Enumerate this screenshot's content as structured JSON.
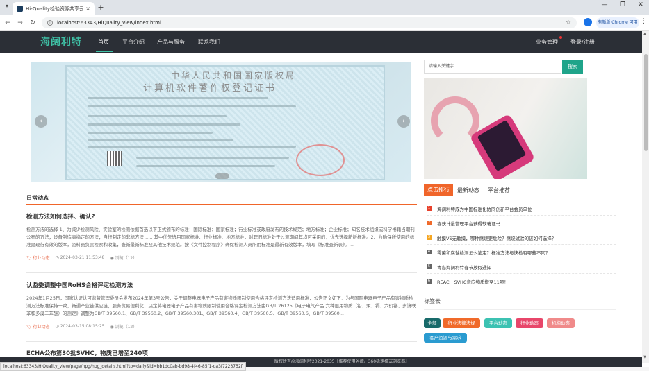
{
  "browser": {
    "tab_title": "Hi-Quality检验资源共享云平台",
    "tab_close": "×",
    "new_tab": "+",
    "url": "localhost:63343/HiQuality_view/index.html",
    "update_button": "有新版 Chrome 可用",
    "status_url": "localhost:63343/HiQuality_view/page/hpg/hpg_details.html?to=daily&id=bb1dc0ab-bd98-4f46-85f1-da3f7223752f"
  },
  "site": {
    "logo": "海阔利特",
    "nav": [
      "首页",
      "平台介绍",
      "产品与服务",
      "联系我们"
    ],
    "nav_right": [
      "业务管理",
      "登录/注册"
    ]
  },
  "main": {
    "section_title": "日常动态",
    "articles": [
      {
        "title": "检测方法如何选择、确认?",
        "body": "检测方法的选择 1、为减少检测风险、实验室的检测依据首选以下正式颁布的标准：国际标准；国家标准；行业标准或政府发布的技术规范；地方标准；企业标准；知名技术组织或科学书籍当期刊公布的方法；设备制造商指定的方法；自行制定的非标方法 ..... 其中优先选用国家标准、行业标准、地方标准，对职旧标准处于过渡期间其均可采用的，优先选择新版标准。2、为确保所使用的标准是现行有效的版本，资料员负责检索和收集，查新最新标准及其他技术规范。按《文件控制程序》确保检测人员所用标准是最新有效版本，填写《标准查新表》。...",
        "tag": "行业动态",
        "date": "2024-03-21 11:53:48",
        "views": "浏览（12）"
      },
      {
        "title": "认监委调整中国RoHS合格评定检测方法",
        "body": "2024年1月25日，国家认证认可监督管理委员会发布2024年第3号公告，关于调整电器电子产品有害物质限制使用合格评定检测方法适用标准，公告正文如下：为与国际电器电子产品有害物质检测方法标准保持一致，畅通产业链供应链，服务贸易便利化，决定将电器电子产品有害物质限制使用合格评定检测方法由GB/T 26125《电子电气产品 六种限用物质（铅、汞、镉、六价铬、多溴联苯和多溴二苯醚）的测定》调整为GB/T 39560.1、GB/T 39560.2、GB/T 39560.301、GB/T 39560.4、GB/T 39560.5、GB/T 39560.6、GB/T 39560...",
        "tag": "行业动态",
        "date": "2024-03-15 08:15:25",
        "views": "浏览（12）"
      },
      {
        "title": "ECHA公布第30批SVHC，物质已增至240项"
      }
    ]
  },
  "sidebar": {
    "search_placeholder": "请输入关键字",
    "search_button": "搜索",
    "rank_tabs": [
      "点击排行",
      "最新动态",
      "平台推荐"
    ],
    "rank_items": [
      {
        "num": "1",
        "text": "海阔利特成为中国标准化协同创新平台会员单位",
        "color": "#e8412c"
      },
      {
        "num": "2",
        "text": "喜获计量管理平台获得软著证书",
        "color": "#f06a2a"
      },
      {
        "num": "3",
        "text": "触摸VS无触摸，哪种燃烧更危险？燃烧试验的该如何选择？",
        "color": "#f5a623"
      },
      {
        "num": "4",
        "text": "霉菌和腐蚀检测怎么鉴定？标准方法与快检有哪些不同？",
        "color": "#666666"
      },
      {
        "num": "5",
        "text": "青岛海阔利特春节放假通知",
        "color": "#666666"
      },
      {
        "num": "6",
        "text": "REACH SVHC意向物质增至11项！",
        "color": "#666666"
      }
    ],
    "tagcloud_title": "标签云",
    "tags": [
      {
        "label": "全部",
        "color": "#186a6a"
      },
      {
        "label": "行业法律法规",
        "color": "#f06a2a"
      },
      {
        "label": "平台动态",
        "color": "#3cc2b2"
      },
      {
        "label": "行业动态",
        "color": "#e8466a"
      },
      {
        "label": "机构动态",
        "color": "#f08a8a"
      },
      {
        "label": "客户资源与需求",
        "color": "#2a9bd0"
      }
    ]
  },
  "footer": {
    "copyright": "版权所有@海阔利特2021-2035【推荐使用谷歌、360极速模式浏览器】"
  },
  "colors": {
    "nav_bg": "#2b2f36",
    "brand_teal": "#1fa48a",
    "accent_orange": "#f0652a"
  }
}
